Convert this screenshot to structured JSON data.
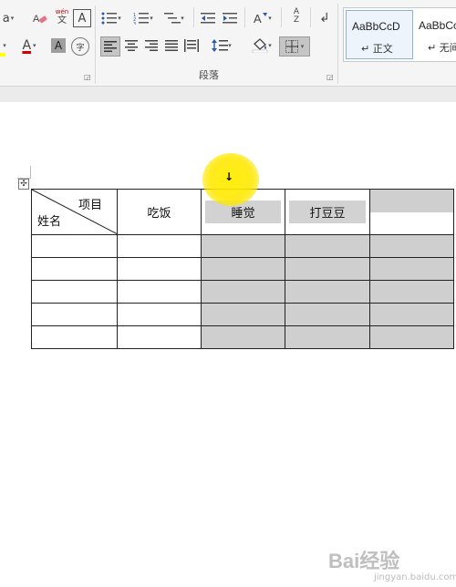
{
  "ribbon": {
    "font_size_suffix": "a",
    "phonetic_top": "wén",
    "phonetic_bottom": "文",
    "char_border": "A",
    "font_color": "A",
    "char_shading": "A",
    "enclose_char": "字",
    "sort_az": "A",
    "sort_z": "Z",
    "paragraph_group_label": "段落",
    "styles": [
      {
        "sample": "AaBbCcD",
        "name": "↵ 正文"
      },
      {
        "sample": "AaBbCcD",
        "name": "↵ 无间"
      }
    ]
  },
  "table": {
    "diagonal_header_top": "项目",
    "diagonal_header_bottom": "姓名",
    "columns": [
      "吃饭",
      "睡觉",
      "打豆豆",
      ""
    ],
    "body_row_count": 5
  },
  "cursor_glyph": "↓",
  "watermark": {
    "main": "Bai经验",
    "sub": "jingyan.baidu.com"
  },
  "colors": {
    "highlight": "#ffe600",
    "selection": "#cfcfcf",
    "font_color_red": "#d40000",
    "text_highlight_yellow": "#ffff00"
  }
}
